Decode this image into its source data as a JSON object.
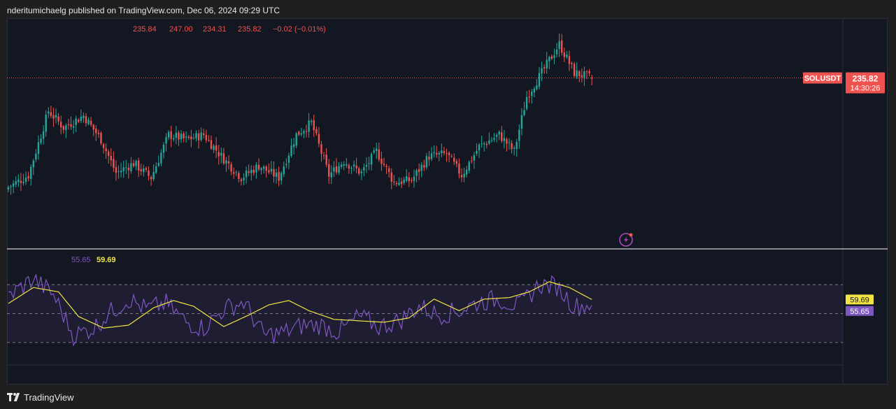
{
  "header": {
    "publisher_text": "nderitumichaelg published on TradingView.com, Dec 06, 2024 09:29 UTC"
  },
  "colors": {
    "background": "#131722",
    "up": "#26a69a",
    "down": "#ef5350",
    "rsi_line": "#7e57c2",
    "rsi_ma": "#f0e442",
    "price_label": "#ef5350"
  },
  "chart_data": [
    {
      "type": "candlestick",
      "symbol": "SOLUSDT",
      "ohlc_label": {
        "open": "235.84",
        "high": "247.00",
        "low": "234.31",
        "close": "235.82",
        "change": "−0.02 (−0.01%)"
      },
      "last_price_label": "235.82",
      "countdown_label": "14:30:26",
      "last_price": 235.82,
      "price_range": [
        170,
        255
      ],
      "anchor_closes": [
        {
          "i": 0,
          "close": 190
        },
        {
          "i": 8,
          "close": 195
        },
        {
          "i": 16,
          "close": 222
        },
        {
          "i": 22,
          "close": 215
        },
        {
          "i": 30,
          "close": 220
        },
        {
          "i": 37,
          "close": 210
        },
        {
          "i": 43,
          "close": 196
        },
        {
          "i": 50,
          "close": 200
        },
        {
          "i": 57,
          "close": 194
        },
        {
          "i": 64,
          "close": 212
        },
        {
          "i": 71,
          "close": 210
        },
        {
          "i": 78,
          "close": 212
        },
        {
          "i": 85,
          "close": 203
        },
        {
          "i": 93,
          "close": 194
        },
        {
          "i": 100,
          "close": 199
        },
        {
          "i": 108,
          "close": 194
        },
        {
          "i": 115,
          "close": 212
        },
        {
          "i": 121,
          "close": 217
        },
        {
          "i": 128,
          "close": 195
        },
        {
          "i": 134,
          "close": 201
        },
        {
          "i": 141,
          "close": 196
        },
        {
          "i": 147,
          "close": 205
        },
        {
          "i": 154,
          "close": 192
        },
        {
          "i": 161,
          "close": 193
        },
        {
          "i": 168,
          "close": 203
        },
        {
          "i": 175,
          "close": 204
        },
        {
          "i": 181,
          "close": 195
        },
        {
          "i": 188,
          "close": 207
        },
        {
          "i": 196,
          "close": 212
        },
        {
          "i": 202,
          "close": 205
        },
        {
          "i": 207,
          "close": 228
        },
        {
          "i": 213,
          "close": 238
        },
        {
          "i": 220,
          "close": 250
        },
        {
          "i": 226,
          "close": 238
        },
        {
          "i": 233,
          "close": 235.82
        }
      ]
    },
    {
      "type": "line",
      "indicator": "RSI",
      "legend": {
        "rsi": "55.65",
        "rsi_ma": "59.69"
      },
      "rsi_value": 55.65,
      "rsi_ma_value": 59.69,
      "bands": [
        30,
        50,
        70
      ],
      "series": [
        {
          "name": "RSI",
          "anchors": [
            [
              0,
              62
            ],
            [
              10,
              74
            ],
            [
              18,
              63
            ],
            [
              26,
              35
            ],
            [
              34,
              40
            ],
            [
              40,
              50
            ],
            [
              48,
              60
            ],
            [
              55,
              53
            ],
            [
              63,
              57
            ],
            [
              71,
              44
            ],
            [
              78,
              40
            ],
            [
              86,
              53
            ],
            [
              94,
              58
            ],
            [
              102,
              35
            ],
            [
              110,
              37
            ],
            [
              118,
              42
            ],
            [
              125,
              42
            ],
            [
              132,
              37
            ],
            [
              140,
              48
            ],
            [
              148,
              41
            ],
            [
              156,
              45
            ],
            [
              164,
              55
            ],
            [
              172,
              49
            ],
            [
              180,
              52
            ],
            [
              188,
              58
            ],
            [
              196,
              60
            ],
            [
              204,
              55
            ],
            [
              212,
              70
            ],
            [
              219,
              69
            ],
            [
              226,
              55
            ],
            [
              233,
              56
            ]
          ]
        },
        {
          "name": "RSI-based MA",
          "anchors": [
            [
              0,
              57
            ],
            [
              10,
              68
            ],
            [
              20,
              65
            ],
            [
              28,
              48
            ],
            [
              38,
              40
            ],
            [
              48,
              42
            ],
            [
              58,
              54
            ],
            [
              66,
              59
            ],
            [
              74,
              55
            ],
            [
              86,
              41
            ],
            [
              96,
              49
            ],
            [
              104,
              56
            ],
            [
              112,
              59
            ],
            [
              120,
              52
            ],
            [
              130,
              46
            ],
            [
              140,
              45
            ],
            [
              150,
              44
            ],
            [
              160,
              47
            ],
            [
              170,
              60
            ],
            [
              180,
              52
            ],
            [
              190,
              60
            ],
            [
              200,
              61
            ],
            [
              208,
              65
            ],
            [
              216,
              72
            ],
            [
              224,
              68
            ],
            [
              233,
              59.69
            ]
          ]
        }
      ]
    }
  ],
  "footer": {
    "brand": "TradingView"
  }
}
